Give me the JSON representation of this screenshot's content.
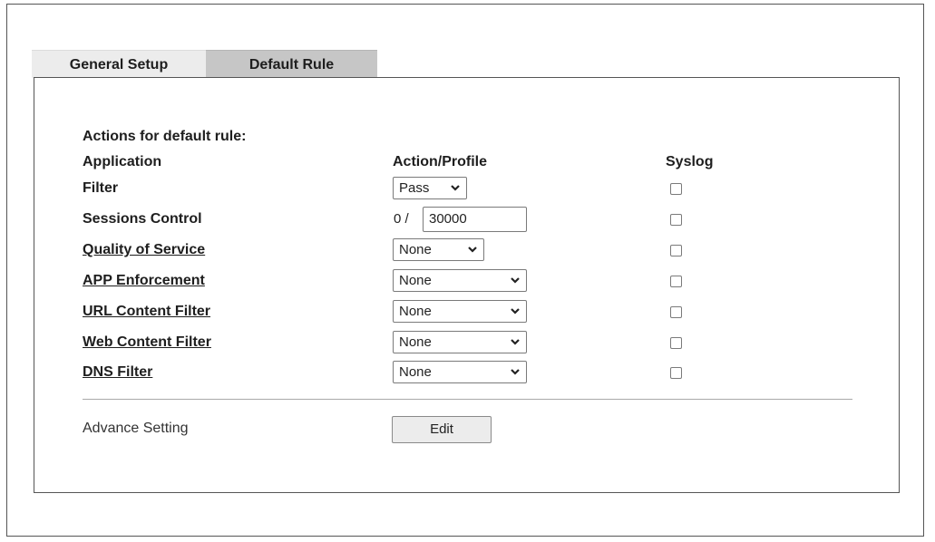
{
  "tabs": {
    "general_setup": "General Setup",
    "default_rule": "Default Rule"
  },
  "rule": {
    "heading": "Actions for default rule:",
    "columns": {
      "application": "Application",
      "action_profile": "Action/Profile",
      "syslog": "Syslog"
    },
    "rows": [
      {
        "label": "Filter",
        "control": "select",
        "value": "Pass",
        "syslog": false
      },
      {
        "label": "Sessions Control",
        "control": "sessions",
        "prefix": "0 /",
        "value": "30000",
        "syslog": false
      },
      {
        "label": "Quality of Service",
        "control": "select",
        "value": "None",
        "syslog": false
      },
      {
        "label": "APP Enforcement",
        "control": "select",
        "value": "None",
        "syslog": false
      },
      {
        "label": "URL Content Filter",
        "control": "select",
        "value": "None",
        "syslog": false
      },
      {
        "label": "Web Content Filter",
        "control": "select",
        "value": "None",
        "syslog": false
      },
      {
        "label": "DNS Filter",
        "control": "select",
        "value": "None",
        "syslog": false
      }
    ]
  },
  "advance": {
    "label": "Advance Setting",
    "button": "Edit"
  }
}
